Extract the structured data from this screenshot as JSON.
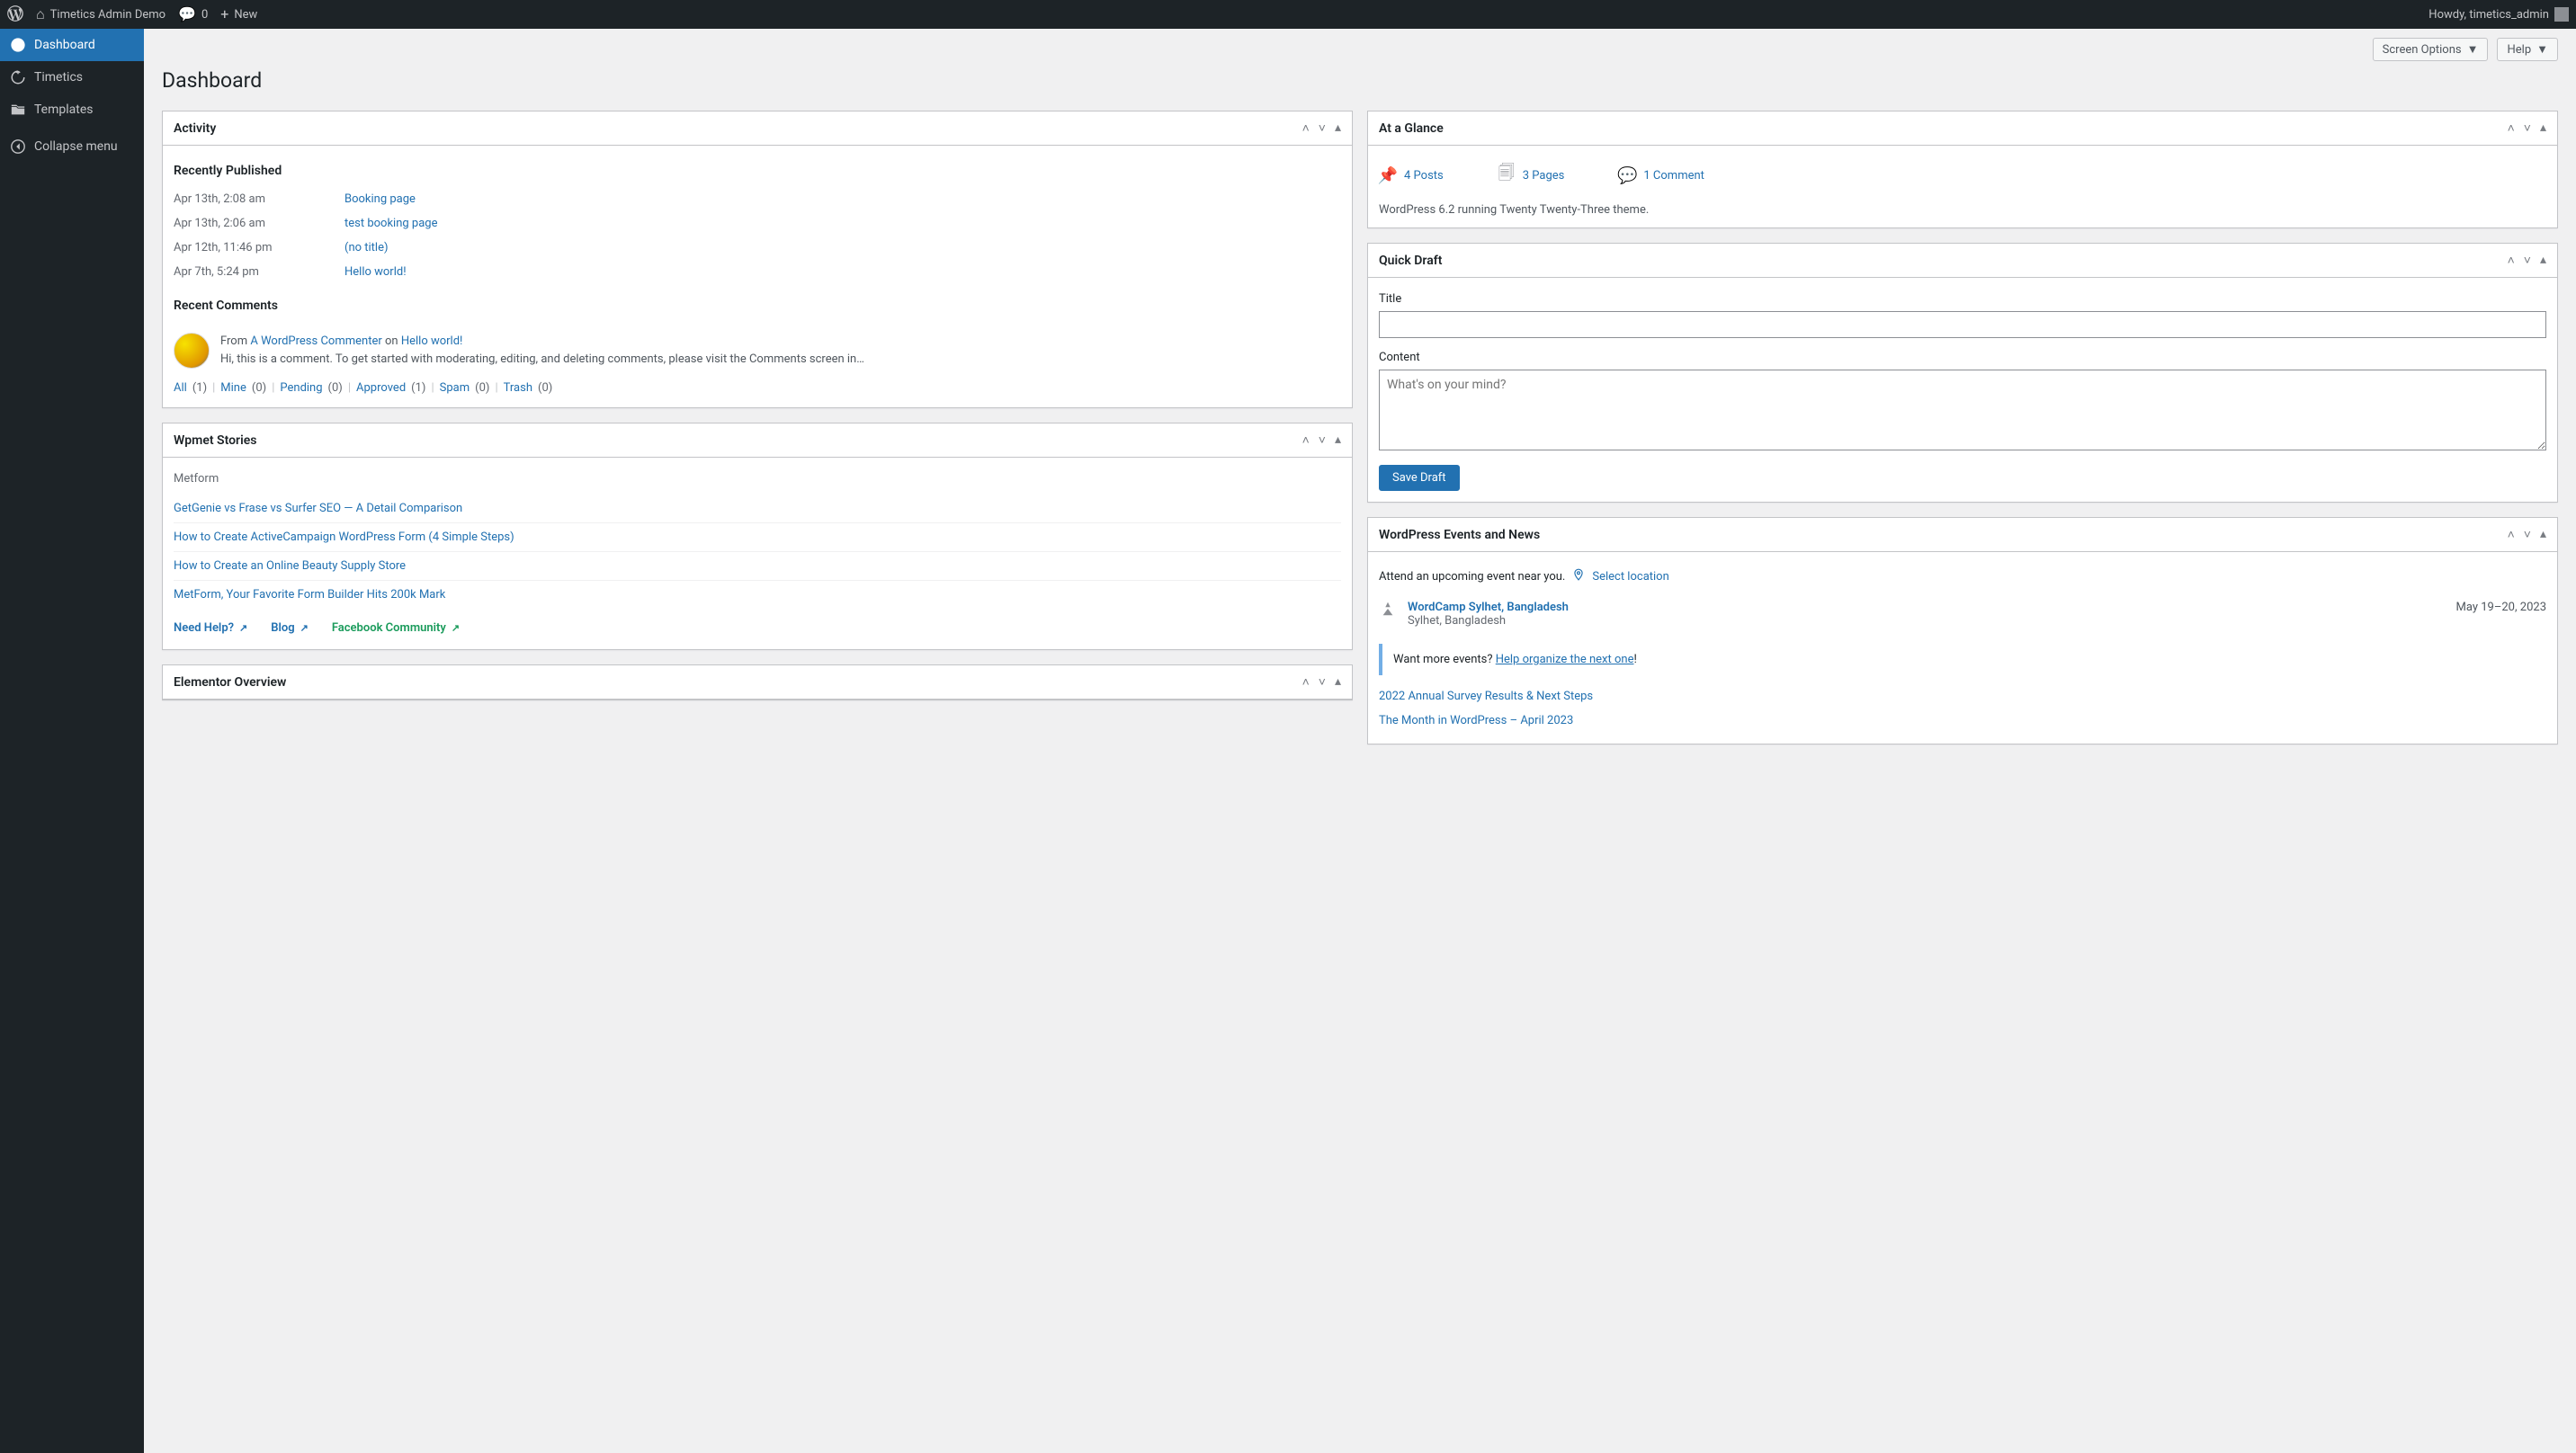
{
  "adminbar": {
    "site_name": "Timetics Admin Demo",
    "comments": "0",
    "new": "New",
    "greeting": "Howdy, timetics_admin"
  },
  "sidebar": {
    "items": [
      {
        "label": "Dashboard",
        "icon": "⌂",
        "active": true
      },
      {
        "label": "Timetics",
        "icon": "⟳",
        "active": false
      },
      {
        "label": "Templates",
        "icon": "🗂",
        "active": false
      },
      {
        "label": "Collapse menu",
        "icon": "◀",
        "active": false
      }
    ]
  },
  "screen": {
    "options": "Screen Options",
    "help": "Help",
    "title": "Dashboard"
  },
  "activity": {
    "title": "Activity",
    "recently_published": "Recently Published",
    "posts": [
      {
        "date": "Apr 13th, 2:08 am",
        "title": "Booking page"
      },
      {
        "date": "Apr 13th, 2:06 am",
        "title": "test booking page"
      },
      {
        "date": "Apr 12th, 11:46 pm",
        "title": "(no title)"
      },
      {
        "date": "Apr 7th, 5:24 pm",
        "title": "Hello world!"
      }
    ],
    "recent_comments": "Recent Comments",
    "comment": {
      "from": "From",
      "author": "A WordPress Commenter",
      "on": "on",
      "post": "Hello world!",
      "text": "Hi, this is a comment. To get started with moderating, editing, and deleting comments, please visit the Comments screen in…"
    },
    "filters": {
      "all": "All",
      "all_n": "(1)",
      "mine": "Mine",
      "mine_n": "(0)",
      "pending": "Pending",
      "pending_n": "(0)",
      "approved": "Approved",
      "approved_n": "(1)",
      "spam": "Spam",
      "spam_n": "(0)",
      "trash": "Trash",
      "trash_n": "(0)"
    }
  },
  "wpmet": {
    "title": "Wpmet Stories",
    "category": "Metform",
    "stories": [
      "GetGenie vs Frase vs Surfer SEO — A Detail Comparison",
      "How to Create ActiveCampaign WordPress Form (4 Simple Steps)",
      "How to Create an Online Beauty Supply Store",
      "MetForm, Your Favorite Form Builder Hits 200k Mark"
    ],
    "need_help": "Need Help?",
    "blog": "Blog",
    "facebook": "Facebook Community"
  },
  "elementor": {
    "title": "Elementor Overview"
  },
  "glance": {
    "title": "At a Glance",
    "posts": "4 Posts",
    "pages": "3 Pages",
    "comments": "1 Comment",
    "version": "WordPress 6.2 running Twenty Twenty-Three theme."
  },
  "quickdraft": {
    "title": "Quick Draft",
    "title_label": "Title",
    "content_label": "Content",
    "placeholder": "What's on your mind?",
    "save": "Save Draft"
  },
  "events": {
    "title": "WordPress Events and News",
    "near": "Attend an upcoming event near you.",
    "select_location": "Select location",
    "event": {
      "name": "WordCamp Sylhet, Bangladesh",
      "location": "Sylhet, Bangladesh",
      "date": "May 19–20, 2023"
    },
    "want_more": "Want more events?",
    "organize": "Help organize the next one",
    "news": [
      "2022 Annual Survey Results & Next Steps",
      "The Month in WordPress – April 2023"
    ]
  }
}
